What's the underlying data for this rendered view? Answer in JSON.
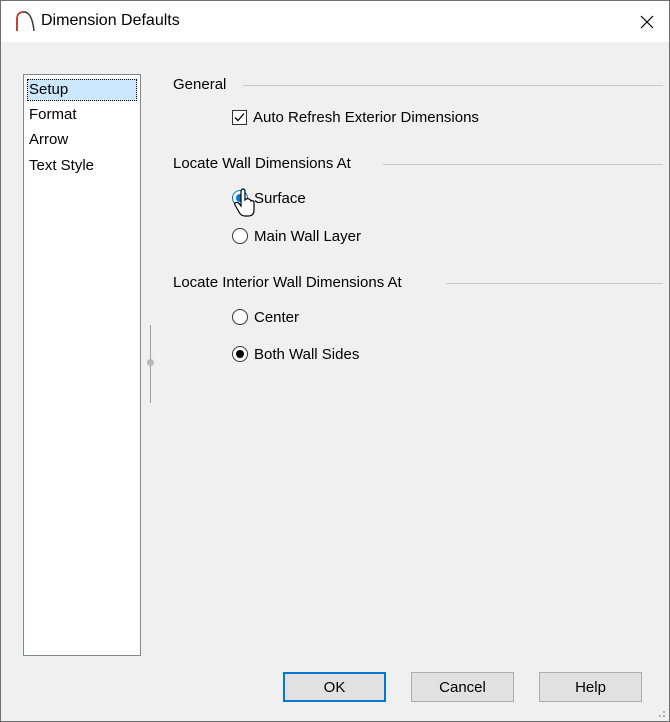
{
  "window": {
    "title": "Dimension Defaults"
  },
  "sidebar": {
    "items": [
      {
        "label": "Setup",
        "selected": true
      },
      {
        "label": "Format",
        "selected": false
      },
      {
        "label": "Arrow",
        "selected": false
      },
      {
        "label": "Text Style",
        "selected": false
      }
    ]
  },
  "general": {
    "heading": "General",
    "auto_refresh": {
      "label": "Auto Refresh Exterior Dimensions",
      "checked": true
    }
  },
  "wall_dims": {
    "heading": "Locate Wall Dimensions At",
    "options": [
      {
        "label": "Surface",
        "selected": true
      },
      {
        "label": "Main Wall Layer",
        "selected": false
      }
    ]
  },
  "interior_dims": {
    "heading": "Locate Interior Wall Dimensions At",
    "options": [
      {
        "label": "Center",
        "selected": false
      },
      {
        "label": "Both Wall Sides",
        "selected": true
      }
    ]
  },
  "buttons": {
    "ok": "OK",
    "cancel": "Cancel",
    "help": "Help"
  },
  "colors": {
    "accent": "#0078d7",
    "selection": "#cce8ff",
    "app_icon": "#c0392b"
  }
}
